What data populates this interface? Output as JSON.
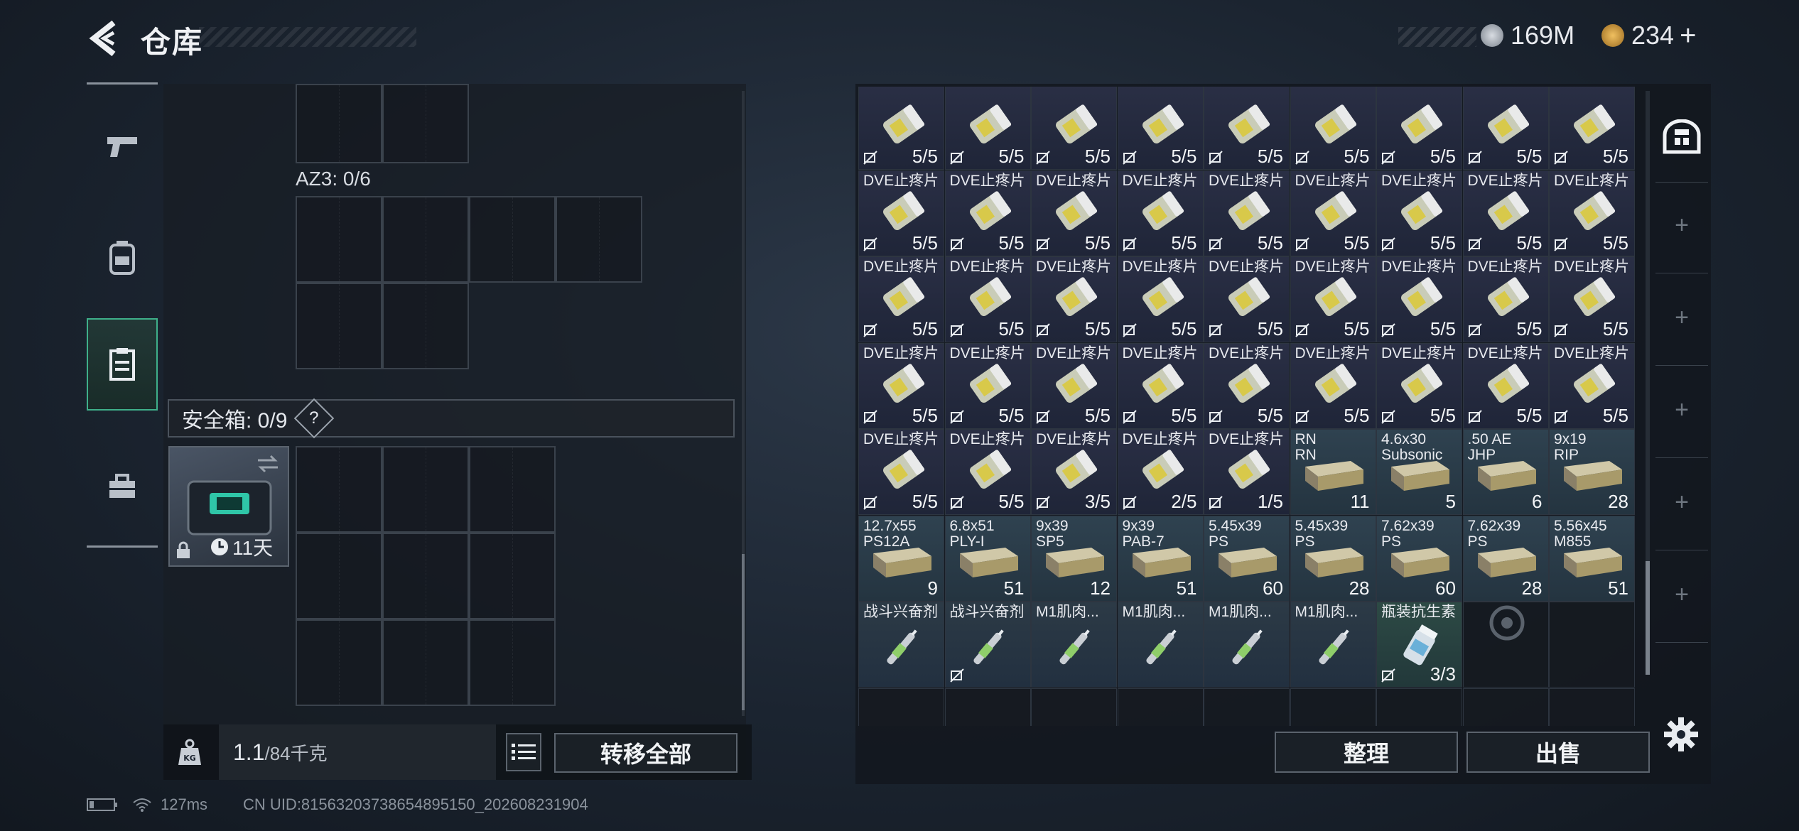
{
  "header": {
    "title": "仓库",
    "currency1": "169M",
    "currency2": "234"
  },
  "left": {
    "az3_label": "AZ3: 0/6",
    "safe_label": "安全箱: 0/9",
    "safe_help": "?",
    "safebox_days": "11天",
    "weight_value": "1.1",
    "weight_max": "/84千克",
    "transfer_all": "转移全部"
  },
  "right": {
    "sort_label": "整理",
    "sell_label": "出售"
  },
  "grid": {
    "row0": [
      {
        "name": "",
        "sub": "",
        "count": "5/5",
        "kind": "med"
      },
      {
        "name": "",
        "sub": "",
        "count": "5/5",
        "kind": "med"
      },
      {
        "name": "",
        "sub": "",
        "count": "5/5",
        "kind": "med"
      },
      {
        "name": "",
        "sub": "",
        "count": "5/5",
        "kind": "med"
      },
      {
        "name": "",
        "sub": "",
        "count": "5/5",
        "kind": "med"
      },
      {
        "name": "",
        "sub": "",
        "count": "5/5",
        "kind": "med"
      },
      {
        "name": "",
        "sub": "",
        "count": "5/5",
        "kind": "med"
      },
      {
        "name": "",
        "sub": "",
        "count": "5/5",
        "kind": "med"
      },
      {
        "name": "",
        "sub": "",
        "count": "5/5",
        "kind": "med"
      }
    ],
    "row1": [
      {
        "name": "DVE止疼片",
        "sub": "",
        "count": "5/5",
        "kind": "med"
      },
      {
        "name": "DVE止疼片",
        "sub": "",
        "count": "5/5",
        "kind": "med"
      },
      {
        "name": "DVE止疼片",
        "sub": "",
        "count": "5/5",
        "kind": "med"
      },
      {
        "name": "DVE止疼片",
        "sub": "",
        "count": "5/5",
        "kind": "med"
      },
      {
        "name": "DVE止疼片",
        "sub": "",
        "count": "5/5",
        "kind": "med"
      },
      {
        "name": "DVE止疼片",
        "sub": "",
        "count": "5/5",
        "kind": "med"
      },
      {
        "name": "DVE止疼片",
        "sub": "",
        "count": "5/5",
        "kind": "med"
      },
      {
        "name": "DVE止疼片",
        "sub": "",
        "count": "5/5",
        "kind": "med"
      },
      {
        "name": "DVE止疼片",
        "sub": "",
        "count": "5/5",
        "kind": "med"
      }
    ],
    "row2": [
      {
        "name": "DVE止疼片",
        "sub": "",
        "count": "5/5",
        "kind": "med"
      },
      {
        "name": "DVE止疼片",
        "sub": "",
        "count": "5/5",
        "kind": "med"
      },
      {
        "name": "DVE止疼片",
        "sub": "",
        "count": "5/5",
        "kind": "med"
      },
      {
        "name": "DVE止疼片",
        "sub": "",
        "count": "5/5",
        "kind": "med"
      },
      {
        "name": "DVE止疼片",
        "sub": "",
        "count": "5/5",
        "kind": "med"
      },
      {
        "name": "DVE止疼片",
        "sub": "",
        "count": "5/5",
        "kind": "med"
      },
      {
        "name": "DVE止疼片",
        "sub": "",
        "count": "5/5",
        "kind": "med"
      },
      {
        "name": "DVE止疼片",
        "sub": "",
        "count": "5/5",
        "kind": "med"
      },
      {
        "name": "DVE止疼片",
        "sub": "",
        "count": "5/5",
        "kind": "med"
      }
    ],
    "row3": [
      {
        "name": "DVE止疼片",
        "sub": "",
        "count": "5/5",
        "kind": "med"
      },
      {
        "name": "DVE止疼片",
        "sub": "",
        "count": "5/5",
        "kind": "med"
      },
      {
        "name": "DVE止疼片",
        "sub": "",
        "count": "5/5",
        "kind": "med"
      },
      {
        "name": "DVE止疼片",
        "sub": "",
        "count": "5/5",
        "kind": "med"
      },
      {
        "name": "DVE止疼片",
        "sub": "",
        "count": "5/5",
        "kind": "med"
      },
      {
        "name": "DVE止疼片",
        "sub": "",
        "count": "5/5",
        "kind": "med"
      },
      {
        "name": "DVE止疼片",
        "sub": "",
        "count": "5/5",
        "kind": "med"
      },
      {
        "name": "DVE止疼片",
        "sub": "",
        "count": "5/5",
        "kind": "med"
      },
      {
        "name": "DVE止疼片",
        "sub": "",
        "count": "5/5",
        "kind": "med"
      }
    ],
    "row4": [
      {
        "name": "DVE止疼片",
        "sub": "",
        "count": "5/5",
        "kind": "med"
      },
      {
        "name": "DVE止疼片",
        "sub": "",
        "count": "5/5",
        "kind": "med"
      },
      {
        "name": "DVE止疼片",
        "sub": "",
        "count": "3/5",
        "kind": "med"
      },
      {
        "name": "DVE止疼片",
        "sub": "",
        "count": "2/5",
        "kind": "med"
      },
      {
        "name": "DVE止疼片",
        "sub": "",
        "count": "1/5",
        "kind": "med"
      },
      {
        "name": "RN",
        "sub": "RN",
        "count": "11",
        "kind": "ammo"
      },
      {
        "name": "4.6x30",
        "sub": "Subsonic",
        "count": "5",
        "kind": "ammo"
      },
      {
        "name": ".50 AE",
        "sub": "JHP",
        "count": "6",
        "kind": "ammo"
      },
      {
        "name": "9x19",
        "sub": "RIP",
        "count": "28",
        "kind": "ammo"
      }
    ],
    "row5": [
      {
        "name": "12.7x55",
        "sub": "PS12A",
        "count": "9",
        "kind": "ammo"
      },
      {
        "name": "6.8x51",
        "sub": "PLY-I",
        "count": "51",
        "kind": "ammo"
      },
      {
        "name": "9x39",
        "sub": "SP5",
        "count": "12",
        "kind": "ammo"
      },
      {
        "name": "9x39",
        "sub": "PAB-7",
        "count": "51",
        "kind": "ammo"
      },
      {
        "name": "5.45x39",
        "sub": "PS",
        "count": "60",
        "kind": "ammo"
      },
      {
        "name": "5.45x39",
        "sub": "PS",
        "count": "28",
        "kind": "ammo"
      },
      {
        "name": "7.62x39",
        "sub": "PS",
        "count": "60",
        "kind": "ammo"
      },
      {
        "name": "7.62x39",
        "sub": "PS",
        "count": "28",
        "kind": "ammo"
      },
      {
        "name": "5.56x45",
        "sub": "M855",
        "count": "51",
        "kind": "ammo"
      }
    ],
    "row6": [
      {
        "name": "战斗兴奋剂",
        "sub": "",
        "count": "",
        "kind": "inj"
      },
      {
        "name": "战斗兴奋剂",
        "sub": "",
        "count": "",
        "kind": "inj"
      },
      {
        "name": "M1肌肉...",
        "sub": "",
        "count": "",
        "kind": "inj"
      },
      {
        "name": "M1肌肉...",
        "sub": "",
        "count": "",
        "kind": "inj"
      },
      {
        "name": "M1肌肉...",
        "sub": "",
        "count": "",
        "kind": "inj"
      },
      {
        "name": "M1肌肉...",
        "sub": "",
        "count": "",
        "kind": "inj"
      },
      {
        "name": "瓶装抗生素",
        "sub": "",
        "count": "3/3",
        "kind": "anti"
      },
      {
        "name": "",
        "sub": "",
        "count": "",
        "kind": "empty"
      },
      {
        "name": "",
        "sub": "",
        "count": "",
        "kind": "empty"
      }
    ]
  },
  "status": {
    "ping": "127ms",
    "uid": "CN UID:81563203738654895150_202608231904"
  },
  "colors": {
    "accent": "#3fb08a",
    "med_bg": "#2a2f45",
    "ammo_bg": "#2f4250"
  },
  "icons": [
    "back-arrow-icon",
    "silver-coin-icon",
    "gold-coin-icon",
    "pistol-icon",
    "backpack-icon",
    "chest-rig-icon",
    "toolbox-icon",
    "kg-weight-icon",
    "list-icon",
    "settings-gear-icon",
    "stash-icon",
    "plus-icon",
    "no-drop-icon",
    "clock-icon",
    "lock-icon",
    "swap-icon"
  ]
}
